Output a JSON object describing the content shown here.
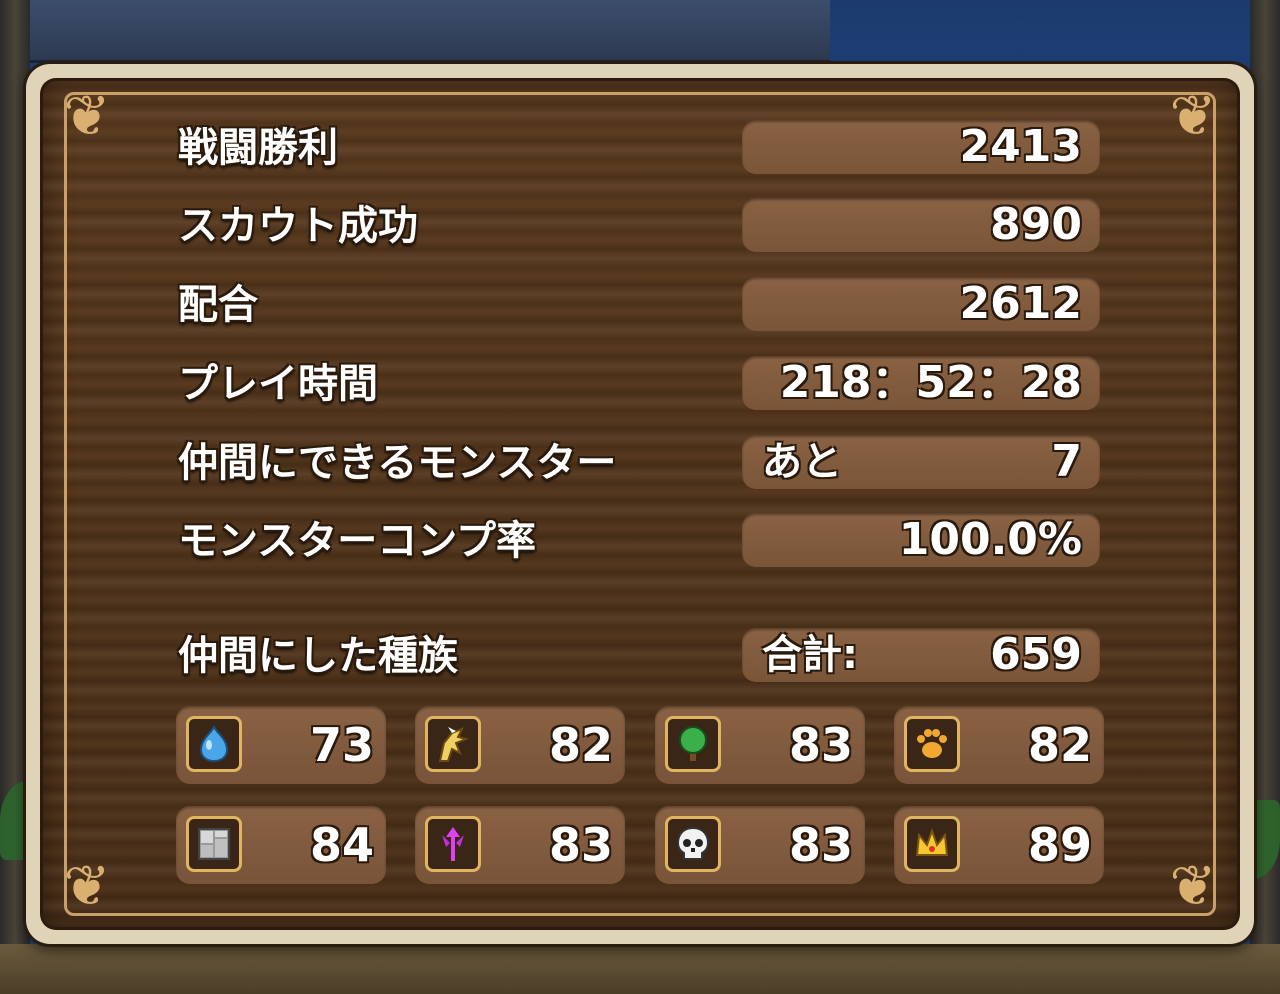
{
  "stats": [
    {
      "label": "戦闘勝利",
      "value": "2413"
    },
    {
      "label": "スカウト成功",
      "value": "890"
    },
    {
      "label": "配合",
      "value": "2612"
    },
    {
      "label": "プレイ時間",
      "value": "218：52：28"
    },
    {
      "label": "仲間にできるモンスター",
      "prefix": "あと",
      "value": "7"
    },
    {
      "label": "モンスターコンプ率",
      "value": "100.0%"
    }
  ],
  "families": {
    "label": "仲間にした種族",
    "total_prefix": "合計:",
    "total": "659",
    "items": [
      {
        "icon": "slime-icon",
        "count": "73"
      },
      {
        "icon": "dragon-icon",
        "count": "82"
      },
      {
        "icon": "tree-icon",
        "count": "83"
      },
      {
        "icon": "paw-icon",
        "count": "82"
      },
      {
        "icon": "material-block-icon",
        "count": "84"
      },
      {
        "icon": "demon-trident-icon",
        "count": "83"
      },
      {
        "icon": "skull-icon",
        "count": "83"
      },
      {
        "icon": "crown-icon",
        "count": "89"
      }
    ]
  },
  "colors": {
    "text": "#ffffff",
    "pill": "#8a6244",
    "wood": "#52341a",
    "frame": "#dfd3b8",
    "icon_border": "#e0b460"
  }
}
